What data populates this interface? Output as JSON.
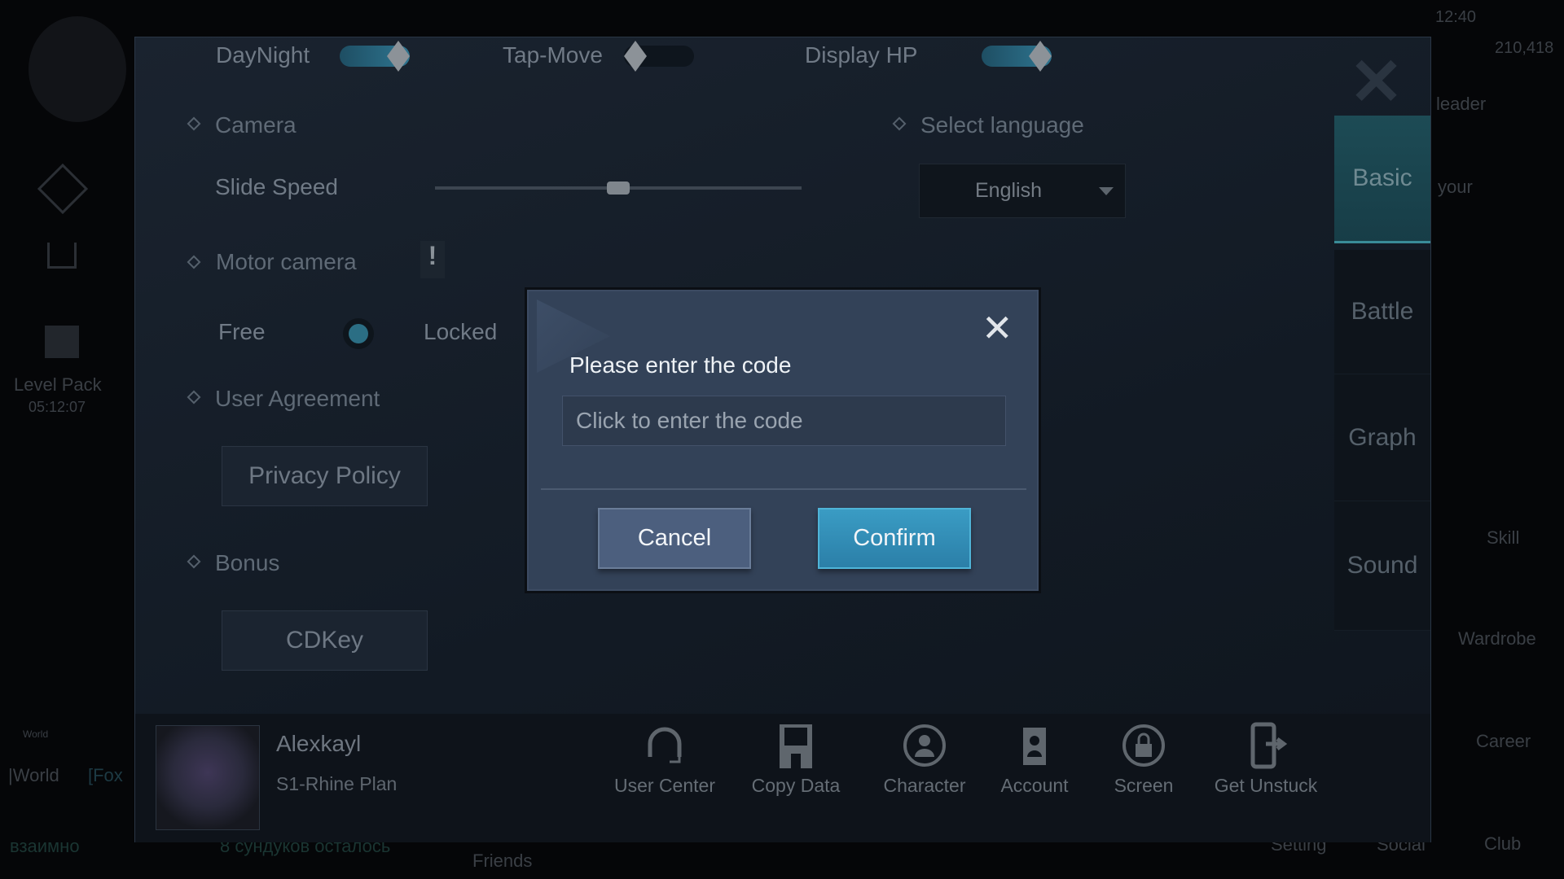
{
  "status_bar": {
    "time": "12:40",
    "currency": "210,418"
  },
  "background_hud": {
    "left": {
      "level_pack_label": "Level Pack",
      "level_pack_timer": "05:12:07",
      "chat_channel": "World",
      "chat_tab_world": "|World",
      "chat_tab_fox": "[Fox",
      "chat_msg_1": "взаимно",
      "chat_msg_2": "8 сундуков осталось"
    },
    "bottom": {
      "friends": "Friends",
      "setting": "Setting",
      "social": "Social"
    },
    "right": {
      "leader": "leader",
      "your": "your",
      "skill": "Skill",
      "wardrobe": "Wardrobe",
      "career": "Career",
      "club": "Club"
    }
  },
  "settings": {
    "toggles": [
      {
        "label": "DayNight",
        "on": true
      },
      {
        "label": "Tap-Move",
        "on": false
      },
      {
        "label": "Display HP",
        "on": true
      }
    ],
    "camera": {
      "section": "Camera",
      "slide_speed_label": "Slide Speed",
      "slide_speed_value": 0.5
    },
    "language": {
      "section": "Select language",
      "selected": "English"
    },
    "motor_camera": {
      "section": "Motor camera",
      "info_icon": "!",
      "option_free": "Free",
      "option_locked": "Locked",
      "selected": "Free"
    },
    "user_agreement": {
      "section": "User Agreement",
      "privacy_policy": "Privacy Policy"
    },
    "bonus": {
      "section": "Bonus",
      "cdkey": "CDKey"
    },
    "tabs": [
      {
        "label": "Basic",
        "active": true
      },
      {
        "label": "Battle"
      },
      {
        "label": "Graph"
      },
      {
        "label": "Sound"
      }
    ],
    "profile": {
      "name": "Alexkayl",
      "server": "S1-Rhine Plan"
    },
    "actions": [
      {
        "label": "User Center",
        "icon": "headset-icon"
      },
      {
        "label": "Copy Data",
        "icon": "floppy-icon"
      },
      {
        "label": "Character",
        "icon": "character-switch-icon"
      },
      {
        "label": "Account",
        "icon": "account-switch-icon"
      },
      {
        "label": "Screen",
        "icon": "screen-lock-icon"
      },
      {
        "label": "Get Unstuck",
        "icon": "phone-exit-icon"
      }
    ]
  },
  "dialog": {
    "title": "Please enter the code",
    "input_placeholder": "Click to enter the code",
    "input_value": "",
    "cancel": "Cancel",
    "confirm": "Confirm"
  },
  "colors": {
    "accent": "#2f8db5",
    "dialog_bg": "#334258",
    "cancel_bg": "#4c5f7e"
  }
}
